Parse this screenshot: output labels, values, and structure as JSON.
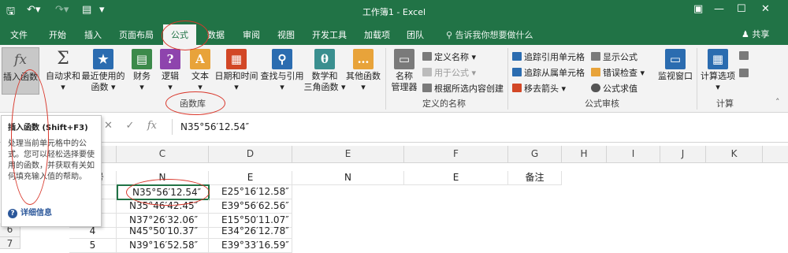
{
  "window": {
    "title": "工作簿1 - Excel"
  },
  "colors": {
    "excel_green": "#217346",
    "annotation_red": "#d9382c",
    "selection_green": "#217346"
  },
  "menu": {
    "tabs": [
      "文件",
      "开始",
      "插入",
      "页面布局",
      "公式",
      "数据",
      "审阅",
      "视图",
      "开发工具",
      "加载项",
      "团队"
    ],
    "active_tab": "公式",
    "search_placeholder": "告诉我你想要做什么",
    "share": "共享"
  },
  "ribbon": {
    "function_library": {
      "insert_function": "插入函数",
      "autosum": "自动求和",
      "recent_line1": "最近使用的",
      "recent_line2": "函数",
      "financial": "财务",
      "logical": "逻辑",
      "text": "文本",
      "datetime": "日期和时间",
      "lookup": "查找与引用",
      "math_line1": "数学和",
      "math_line2": "三角函数",
      "more": "其他函数",
      "group_label": "函数库"
    },
    "defined_names": {
      "name_manager_line1": "名称",
      "name_manager_line2": "管理器",
      "define_name": "定义名称",
      "use_in_formula": "用于公式",
      "create_from_selection": "根据所选内容创建",
      "group_label": "定义的名称"
    },
    "formula_auditing": {
      "trace_precedents": "追踪引用单元格",
      "trace_dependents": "追踪从属单元格",
      "remove_arrows": "移去箭头",
      "show_formulas": "显示公式",
      "error_checking": "错误检查",
      "evaluate_formula": "公式求值",
      "watch_window": "监视窗口",
      "group_label": "公式审核"
    },
    "calculation": {
      "options": "计算选项",
      "group_label": "计算"
    }
  },
  "formula_bar": {
    "fx": "fx",
    "content": "N35°56′12.54″"
  },
  "tooltip": {
    "title": "插入函数 (Shift+F3)",
    "body": "处理当前单元格中的公式。您可以轻松选择要使用的函数，并获取有关如何填充输入值的帮助。",
    "more": "详细信息"
  },
  "sheet": {
    "columns": [
      "C",
      "D",
      "E",
      "F",
      "G",
      "H",
      "I",
      "J",
      "K"
    ],
    "row_numbers": [
      "6",
      "7"
    ],
    "header_row": {
      "c": "N",
      "d": "E",
      "e": "N",
      "f": "E",
      "g": "备注"
    },
    "data_rows": [
      {
        "b": "",
        "c": "N35°56′12.54″",
        "d": "E25°16′12.58″"
      },
      {
        "b": "",
        "c": "N35°46′42.45″",
        "d": "E39°56′62.56″"
      },
      {
        "b": "",
        "c": "N37°26′32.06″",
        "d": "E15°50′11.07″"
      },
      {
        "b": "4",
        "c": "N45°50′10.37″",
        "d": "E34°26′12.78″"
      },
      {
        "b": "5",
        "c": "N39°16′52.58″",
        "d": "E39°33′16.59″"
      }
    ],
    "partial_b1": "号"
  }
}
